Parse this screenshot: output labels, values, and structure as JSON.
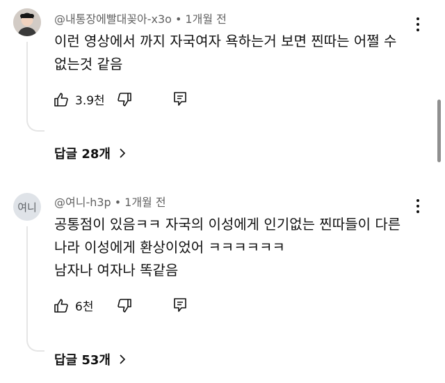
{
  "comments": [
    {
      "author": "@내통장에빨대꽂아-x3o",
      "time": "1개월 전",
      "text": "이런 영상에서 까지 자국여자 욕하는거 보면 찐따는 어쩔 수\n없는것 같음",
      "likes": "3.9천",
      "replies_label": "답글 28개",
      "avatar_icon": "profile-photo-icon"
    },
    {
      "author": "@여니-h3p",
      "time": "1개월 전",
      "text": "공통점이 있음ㅋㅋ 자국의 이성에게 인기없는 찐따들이 다른\n나라 이성에게 환상이었어 ㅋㅋㅋㅋㅋㅋ\n남자나 여자나 똑같음",
      "likes": "6천",
      "replies_label": "답글 53개",
      "avatar_text": "여니"
    }
  ],
  "meta_separator": "•",
  "icons": [
    "like-icon",
    "dislike-icon",
    "reply-icon",
    "more-options-icon",
    "chevron-right-icon"
  ],
  "colors": {
    "text": "#0f0f0f",
    "secondary_text": "#606060",
    "thread_line": "#e5e5e5"
  }
}
